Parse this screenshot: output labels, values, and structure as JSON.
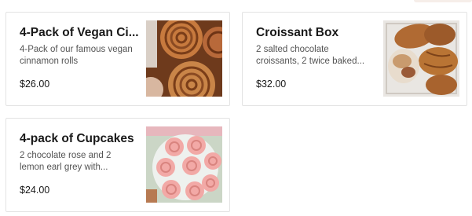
{
  "menu_items": [
    {
      "name": "4-Pack of Vegan Ci...",
      "description_lines": [
        "4-Pack of our famous vegan",
        "cinnamon rolls"
      ],
      "price": "$26.00",
      "image": "cinnamon-rolls-photo"
    },
    {
      "name": "Croissant Box",
      "description_lines": [
        "2 salted chocolate",
        "croissants, 2 twice baked..."
      ],
      "price": "$32.00",
      "image": "croissant-box-photo"
    },
    {
      "name": "4-pack of Cupcakes",
      "description_lines": [
        "2 chocolate rose and 2",
        "lemon earl grey with..."
      ],
      "price": "$24.00",
      "image": "cupcakes-photo"
    }
  ]
}
